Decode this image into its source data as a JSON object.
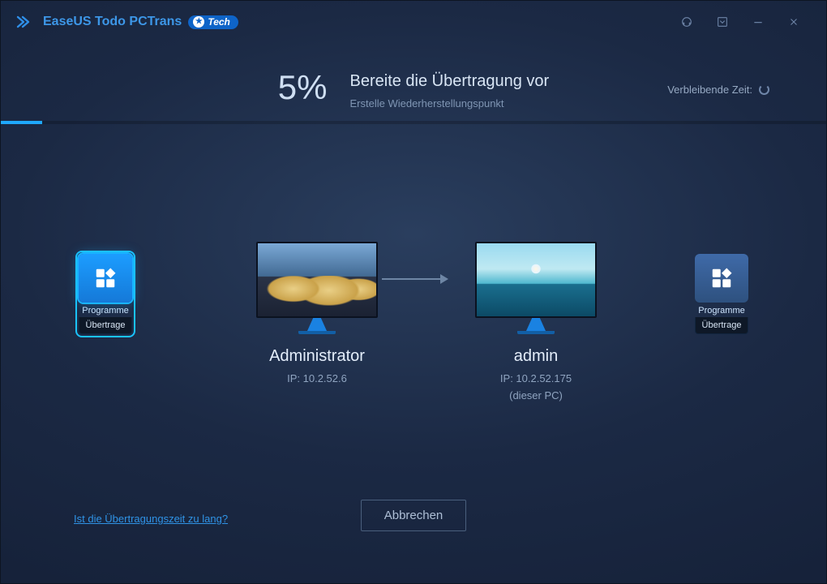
{
  "titlebar": {
    "app_name": "EaseUS Todo PCTrans",
    "badge_text": "Tech"
  },
  "status": {
    "percent": "5%",
    "title": "Bereite die Übertragung vor",
    "subtitle": "Erstelle Wiederherstellungspunkt",
    "remaining_label": "Verbleibende Zeit:"
  },
  "progress": {
    "percent": 5
  },
  "side": {
    "left": {
      "label": "Programme",
      "status": "Übertrage"
    },
    "right": {
      "label": "Programme",
      "status": "Übertrage"
    }
  },
  "pcs": {
    "source": {
      "name": "Administrator",
      "ip": "IP: 10.2.52.6"
    },
    "target": {
      "name": "admin",
      "ip": "IP: 10.2.52.175",
      "note": "(dieser PC)"
    }
  },
  "footer": {
    "help_link": "Ist die Übertragungszeit zu lang?",
    "cancel": "Abbrechen"
  }
}
